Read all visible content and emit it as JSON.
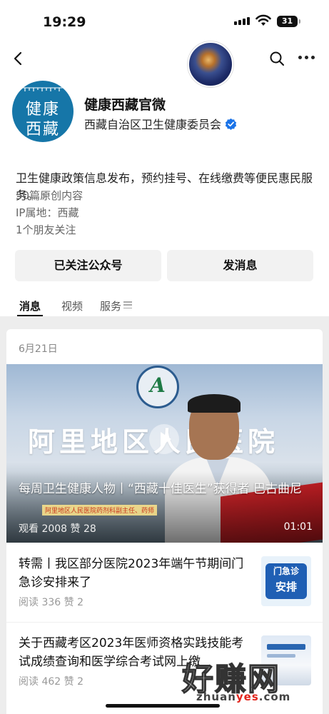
{
  "status_bar": {
    "time": "19:29",
    "battery": "31"
  },
  "profile": {
    "logo_line1": "健康",
    "logo_line2": "西藏",
    "name": "健康西藏官微",
    "org": "西藏自治区卫生健康委员会",
    "description": "卫生健康政策信息发布，预约挂号、在线缴费等便民惠民服务。",
    "original_count": "50篇原创内容",
    "ip_location": "IP属地：西藏",
    "friends_following": "1个朋友关注"
  },
  "buttons": {
    "follow": "已关注公众号",
    "message": "发消息"
  },
  "tabs": [
    {
      "label": "消息"
    },
    {
      "label": "视频"
    },
    {
      "label": "服务"
    }
  ],
  "feed": {
    "date": "6月21日",
    "video": {
      "sign_text": "阿里地区人民医院",
      "title": "每周卫生健康人物丨“西藏十佳医生”获得者 巴古曲尼",
      "caption": "阿里地区人民医院药剂科副主任、药师",
      "views_likes": "观看 2008  赞 28",
      "duration": "01:01"
    },
    "articles": [
      {
        "title": "转需丨我区部分医院2023年端午节期间门急诊安排来了",
        "stats": "阅读 336  赞 2",
        "thumb_line1": "门急诊",
        "thumb_line2": "安排"
      },
      {
        "title": "关于西藏考区2023年医师资格实践技能考试成绩查询和医学综合考试网上缴",
        "stats": "阅读 462  赞 2"
      }
    ]
  },
  "watermark": {
    "main": "好赚网",
    "url_prefix": "zhuan",
    "url_accent": "yes",
    "url_suffix": ".com"
  },
  "colors": {
    "logo_blue": "#1676a8",
    "verified_blue": "#1a73e8",
    "flag_red": "#d6252a"
  }
}
